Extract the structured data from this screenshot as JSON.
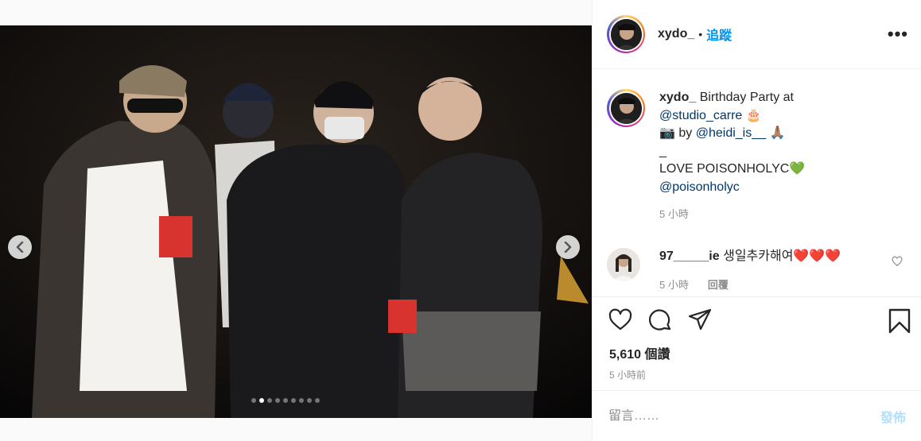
{
  "post": {
    "slide_count": 9,
    "active_slide": 2
  },
  "header": {
    "username": "xydo_",
    "separator": "•",
    "follow_label": "追蹤",
    "more_label": "•••"
  },
  "caption": {
    "username": "xydo_",
    "line1": "Birthday Party at",
    "mention1": "@studio_carre",
    "emoji1": "🎂",
    "camera": "📷",
    "by_label": "by",
    "mention2": "@heidi_is__",
    "emoji2": "🙏🏽",
    "underscore": "_",
    "love_text": "LOVE POISONHOLYC",
    "emoji3": "💚",
    "mention3": "@poisonholyc",
    "time": "5 小時"
  },
  "comment": {
    "username": "97_____ie",
    "text": "생일추카해여❤️❤️❤️",
    "time": "5 小時",
    "reply_label": "回覆"
  },
  "footer": {
    "likes": "5,610 個讚",
    "time": "5 小時前",
    "comment_placeholder": "留言……",
    "post_label": "發佈"
  },
  "icons": {
    "like": "heart-icon",
    "comment": "comment-icon",
    "share": "share-icon",
    "save": "bookmark-icon",
    "prev": "chevron-left-icon",
    "next": "chevron-right-icon"
  }
}
